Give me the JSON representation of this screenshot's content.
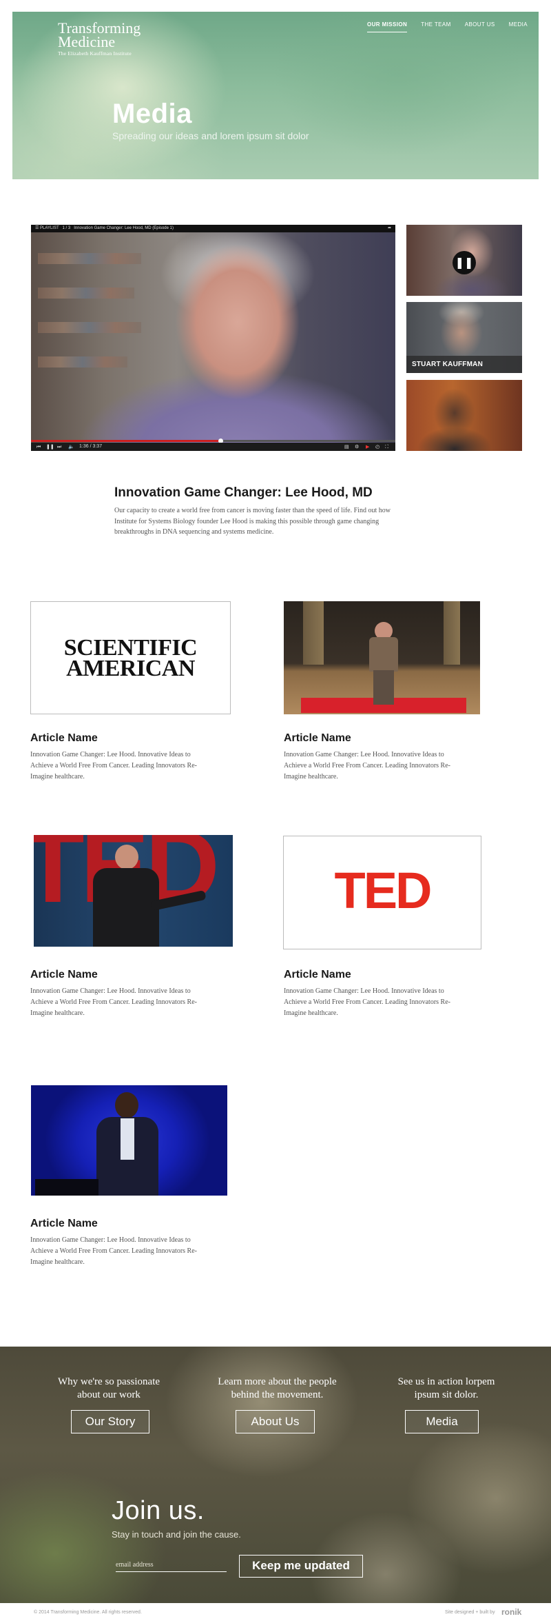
{
  "hero": {
    "logo_line1": "Transforming",
    "logo_line2": "Medicine",
    "logo_tagline": "The Elizabeth Kauffman Institute",
    "nav": [
      "OUR MISSION",
      "THE TEAM",
      "ABOUT US",
      "MEDIA"
    ],
    "title": "Media",
    "subtitle": "Spreading our ideas and lorem ipsum sit dolor"
  },
  "player": {
    "playlist_label": "PLAYLIST",
    "playlist_count": "1 / 3",
    "video_title": "Innovation Game Changer: Lee Hood, MD (Episode 1)",
    "time": "1:36 / 3:37",
    "progress": 0.52,
    "thumbnails": [
      {
        "caption": "",
        "state": "paused"
      },
      {
        "caption": "STUART KAUFFMAN"
      },
      {
        "caption": ""
      }
    ]
  },
  "featured": {
    "title": "Innovation Game Changer: Lee Hood, MD",
    "body": "Our capacity to create a world free from cancer is moving faster than the speed of life. Find out how Institute for Systems Biology founder Lee Hood is making this possible through game changing breakthroughs in DNA sequencing and systems medicine."
  },
  "articles": [
    {
      "image": "scientific-american-logo",
      "logo_line1": "SCIENTIFIC",
      "logo_line2": "AMERICAN",
      "title": "Article Name",
      "body": "Innovation Game Changer: Lee Hood. Innovative Ideas to Achieve a World Free From Cancer. Leading Innovators Re-Imagine healthcare."
    },
    {
      "image": "speaker-on-stage",
      "title": "Article Name",
      "body": "Innovation Game Changer: Lee Hood. Innovative Ideas to Achieve a World Free From Cancer. Leading Innovators Re-Imagine healthcare."
    },
    {
      "image": "ted-speaker",
      "title": "Article Name",
      "body": "Innovation Game Changer: Lee Hood. Innovative Ideas to Achieve a World Free From Cancer. Leading Innovators Re-Imagine healthcare."
    },
    {
      "image": "ted-logo",
      "logo_text": "TED",
      "title": "Article Name",
      "body": "Innovation Game Changer: Lee Hood. Innovative Ideas to Achieve a World Free From Cancer. Leading Innovators Re-Imagine healthcare."
    },
    {
      "image": "speaker-blue-stage",
      "title": "Article Name",
      "body": "Innovation Game Changer: Lee Hood. Innovative Ideas to Achieve a World Free From Cancer. Leading Innovators Re-Imagine healthcare."
    }
  ],
  "footer": {
    "columns": [
      {
        "text_line1": "Why we're so passionate",
        "text_line2": "about our work",
        "button": "Our Story"
      },
      {
        "text_line1": "Learn more about the people",
        "text_line2": "behind the movement.",
        "button": "About Us"
      },
      {
        "text_line1": "See us in action lorpem",
        "text_line2": "ipsum sit dolor.",
        "button": "Media"
      }
    ],
    "join_title": "Join us.",
    "join_subtitle": "Stay in touch and join the cause.",
    "email_placeholder": "email address",
    "subscribe_button": "Keep me updated",
    "copyright": "© 2014 Transforming Medicine. All rights reserved.",
    "credit": "Site designed + built by",
    "credit_brand": "ronik"
  },
  "colors": {
    "hero_green": "#7fb595",
    "ted_red": "#e62b1e",
    "progress_red": "#cc1f1f"
  }
}
